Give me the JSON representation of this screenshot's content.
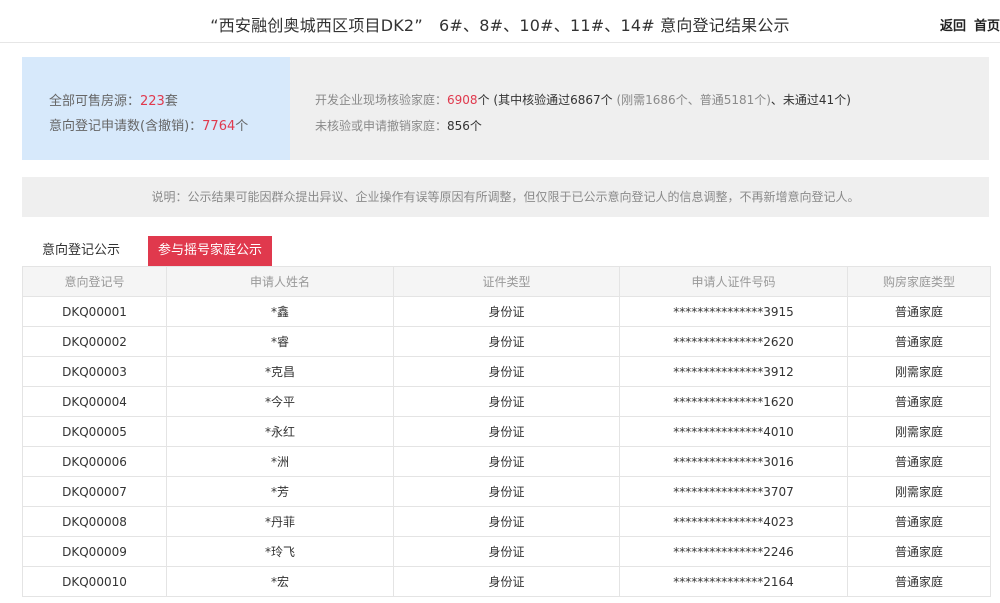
{
  "header": {
    "title": "“西安融创奥城西区项目DK2”　6#、8#、10#、11#、14# 意向登记结果公示",
    "nav_back": "返回",
    "nav_home": "首页"
  },
  "stats": {
    "available_label": "全部可售房源：",
    "available_value": "223",
    "available_unit": "套",
    "applications_label": "意向登记申请数(含撤销)：",
    "applications_value": "7764",
    "applications_unit": "个",
    "verified_label": "开发企业现场核验家庭：",
    "verified_value": "6908",
    "verified_unit": "个",
    "verified_passed": "(其中核验通过6867个",
    "verified_breakdown": "(刚需1686个、普通5181个)",
    "verified_failed": "、未通过41个)",
    "unverified_label": "未核验或申请撤销家庭：",
    "unverified_value": "856个"
  },
  "notice": "说明：公示结果可能因群众提出异议、企业操作有误等原因有所调整，但仅限于已公示意向登记人的信息调整，不再新增意向登记人。",
  "tabs": {
    "registration": "意向登记公示",
    "lottery": "参与摇号家庭公示"
  },
  "table": {
    "columns": [
      "意向登记号",
      "申请人姓名",
      "证件类型",
      "申请人证件号码",
      "购房家庭类型"
    ],
    "rows": [
      [
        "DKQ00001",
        "*鑫",
        "身份证",
        "***************3915",
        "普通家庭"
      ],
      [
        "DKQ00002",
        "*睿",
        "身份证",
        "***************2620",
        "普通家庭"
      ],
      [
        "DKQ00003",
        "*克昌",
        "身份证",
        "***************3912",
        "刚需家庭"
      ],
      [
        "DKQ00004",
        "*今平",
        "身份证",
        "***************1620",
        "普通家庭"
      ],
      [
        "DKQ00005",
        "*永红",
        "身份证",
        "***************4010",
        "刚需家庭"
      ],
      [
        "DKQ00006",
        "*洲",
        "身份证",
        "***************3016",
        "普通家庭"
      ],
      [
        "DKQ00007",
        "*芳",
        "身份证",
        "***************3707",
        "刚需家庭"
      ],
      [
        "DKQ00008",
        "*丹菲",
        "身份证",
        "***************4023",
        "普通家庭"
      ],
      [
        "DKQ00009",
        "*玲飞",
        "身份证",
        "***************2246",
        "普通家庭"
      ],
      [
        "DKQ00010",
        "*宏",
        "身份证",
        "***************2164",
        "普通家庭"
      ]
    ]
  }
}
